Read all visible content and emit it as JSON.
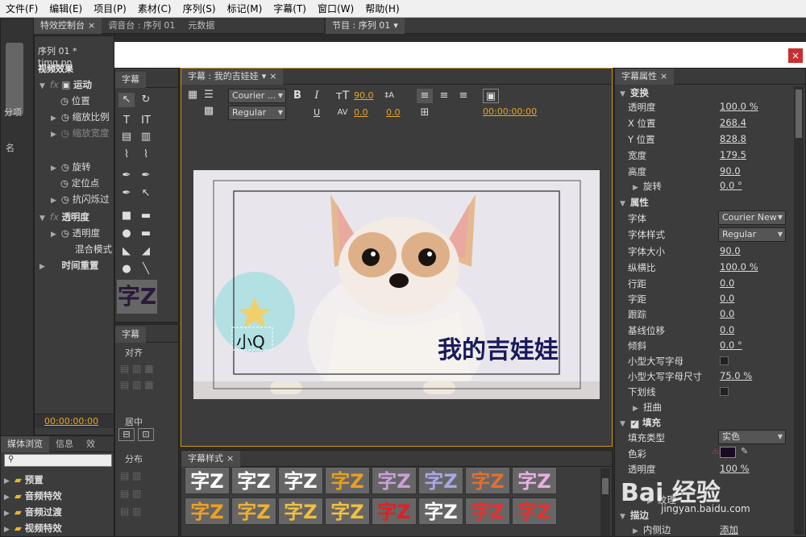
{
  "menu": [
    "文件(F)",
    "编辑(E)",
    "项目(P)",
    "素材(C)",
    "序列(S)",
    "标记(M)",
    "字幕(T)",
    "窗口(W)",
    "帮助(H)"
  ],
  "tabs_top": {
    "effect_controls": "特效控制台",
    "mixer": "调音台 : 序列 01",
    "metadata": "元数据",
    "program": "节目 : 序列 01"
  },
  "effect_controls": {
    "sequence": "序列 01 * timg.pn",
    "video_effects": "视频效果",
    "motion": "运动",
    "items": [
      "位置",
      "缩放比例",
      "缩放宽度",
      "旋转",
      "定位点",
      "抗闪烁过"
    ],
    "opacity": "透明度",
    "opacity_item": "透明度",
    "blend": "混合模式",
    "time_remap": "时间重置",
    "timecode": "00:00:00:00"
  },
  "left_strip": {
    "label1": "分项",
    "label2": "名"
  },
  "titler_tools_tab": "字幕",
  "titler_actions_tab": "字幕",
  "actions": {
    "align": "对齐",
    "center": "居中",
    "distribute": "分布"
  },
  "title_tab": "字幕 : 我的吉娃娃",
  "toolbar": {
    "font": "Courier ...",
    "style": "Regular",
    "size": "90.0",
    "kerning": "0.0",
    "leading": "0.0",
    "tracking": "0.0",
    "timecode": "00:00:00:00"
  },
  "canvas": {
    "main_text": "我的吉娃娃",
    "small_text": "小Q"
  },
  "styles_tab": "字幕样式",
  "style_glyph": "字Z",
  "props_tab": "字幕属性",
  "props": {
    "transform": "变换",
    "t_rows": [
      [
        "透明度",
        "100.0 %"
      ],
      [
        "X 位置",
        "268.4"
      ],
      [
        "Y 位置",
        "828.8"
      ],
      [
        "宽度",
        "179.5"
      ],
      [
        "高度",
        "90.0"
      ],
      [
        "旋转",
        "0.0 °"
      ]
    ],
    "attributes": "属性",
    "font_label": "字体",
    "font_value": "Courier New",
    "style_label": "字体样式",
    "style_value": "Regular",
    "a_rows": [
      [
        "字体大小",
        "90.0"
      ],
      [
        "纵横比",
        "100.0 %"
      ],
      [
        "行距",
        "0.0"
      ],
      [
        "字距",
        "0.0"
      ],
      [
        "跟踪",
        "0.0"
      ],
      [
        "基线位移",
        "0.0"
      ],
      [
        "倾斜",
        "0.0 °"
      ]
    ],
    "smallcaps": "小型大写字母",
    "smallcaps_size": "小型大写字母尺寸",
    "smallcaps_size_value": "75.0 %",
    "underline": "下划线",
    "distort": "扭曲",
    "fill": "填充",
    "fill_type": "填充类型",
    "fill_type_value": "实色",
    "color": "色彩",
    "opacity": "透明度",
    "opacity_value": "100 %",
    "texture": "纹理",
    "stroke": "描边",
    "inner": "内侧边",
    "add": "添加"
  },
  "media": {
    "tab1": "媒体浏览",
    "tab2": "信息",
    "tab3": "效",
    "items": [
      "预置",
      "音频特效",
      "音频过渡",
      "视频特效"
    ]
  },
  "watermark": "Bai 经验",
  "watermark_url": "jingyan.baidu.com",
  "colors": {
    "accent": "#e6a62a",
    "title_text": "#1a1a5c"
  }
}
